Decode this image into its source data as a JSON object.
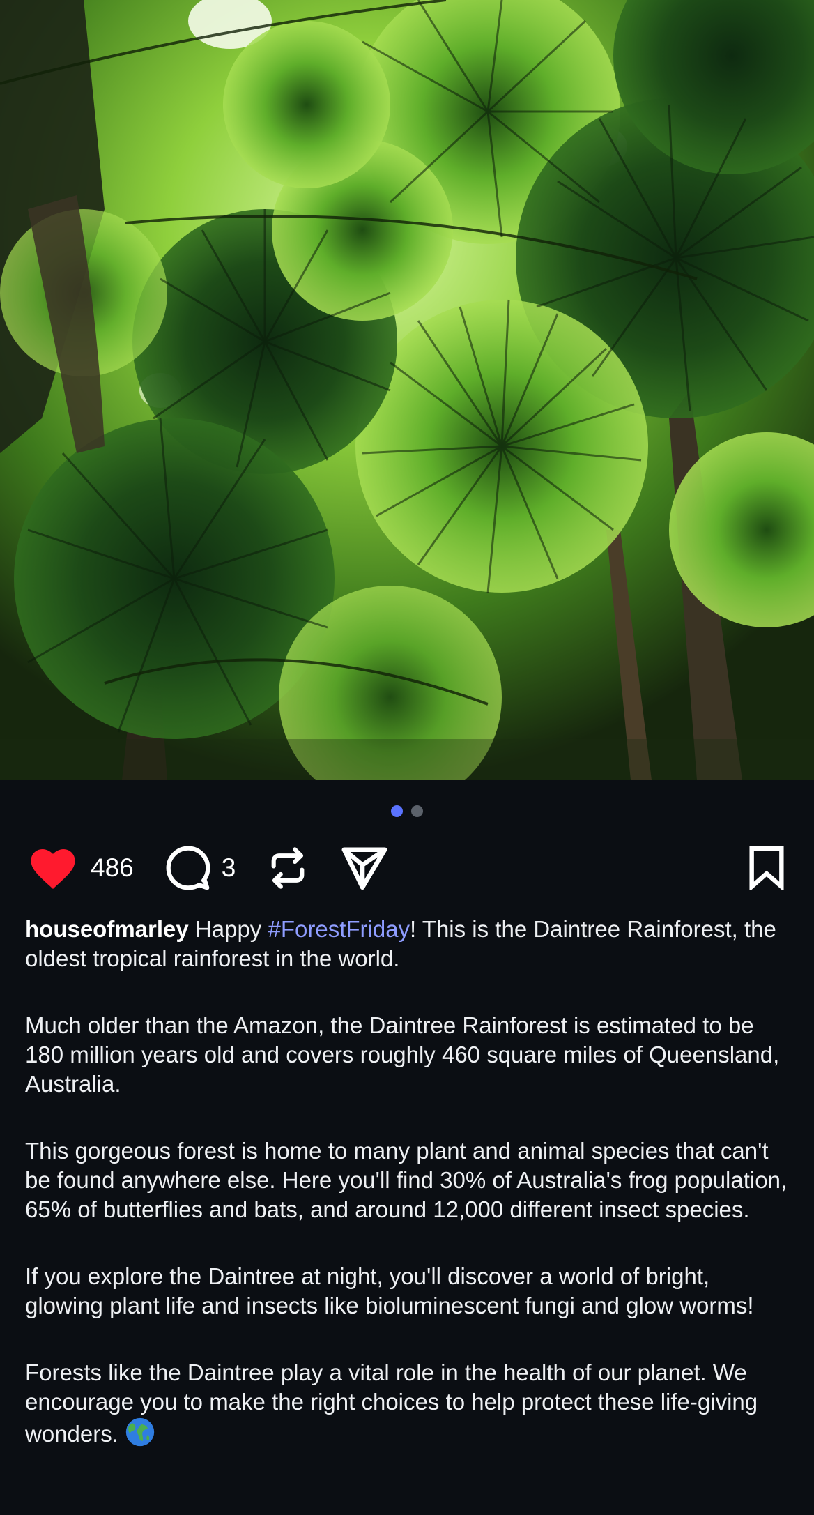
{
  "post": {
    "image_alt": "Low-angle view of fan palm canopy in the Daintree Rainforest",
    "carousel": {
      "total": 2,
      "active_index": 0
    },
    "colors": {
      "like": "#ff1a2e",
      "dot_active": "#5a73ff",
      "dot_inactive": "#5c626b",
      "hashtag": "#8f9dff",
      "background": "#0b0e13"
    },
    "actions": {
      "likes": "486",
      "comments": "3",
      "like_icon": "heart-icon",
      "comment_icon": "comment-bubble-icon",
      "repost_icon": "repost-arrows-icon",
      "share_icon": "send-paper-plane-icon",
      "save_icon": "bookmark-icon"
    },
    "caption": {
      "username": "houseofmarley",
      "intro_before": " Happy ",
      "hashtag": "#ForestFriday",
      "intro_after": "! This is the Daintree Rainforest, the oldest tropical rainforest in the world.",
      "paragraphs": [
        "Much older than the Amazon, the Daintree Rainforest is estimated to be 180 million years old and covers roughly 460 square miles of Queensland, Australia.",
        "This gorgeous forest is home to many plant and animal species that can't be found anywhere else. Here you'll find 30% of Australia's frog population, 65% of butterflies and bats, and around 12,000 different insect species.",
        "If you explore the Daintree at night, you'll discover a world of bright, glowing plant life and insects like bioluminescent fungi and glow worms!"
      ],
      "closing": "Forests like the Daintree play a vital role in the health of our planet. We encourage you to make the right choices to help protect these life-giving wonders.",
      "closing_emoji_icon": "globe-earth-icon"
    }
  }
}
